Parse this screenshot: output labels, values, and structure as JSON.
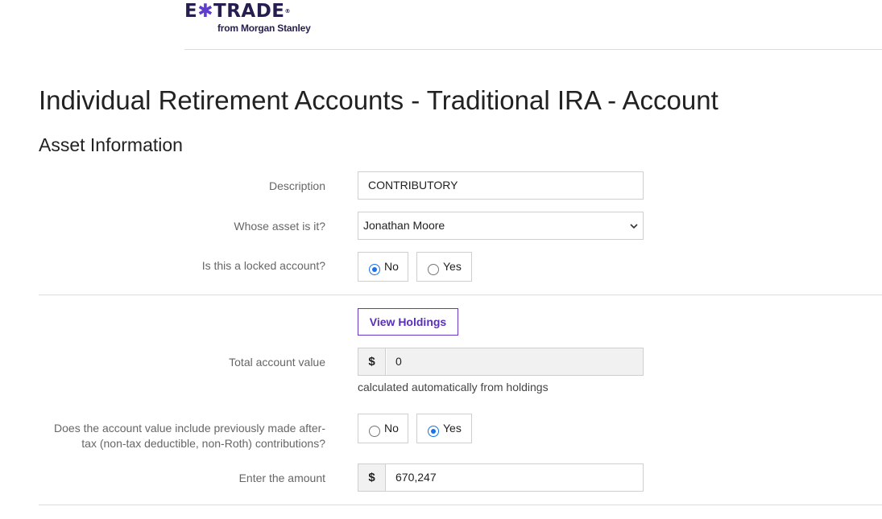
{
  "brand": {
    "logo_parts": [
      "E",
      "✱",
      "TRADE"
    ],
    "registered": "®",
    "sub": "from Morgan Stanley",
    "colors": {
      "navy": "#241f4f",
      "purple": "#5f3bd1"
    }
  },
  "page": {
    "title": "Individual Retirement Accounts - Traditional IRA - Account",
    "section": "Asset Information"
  },
  "form": {
    "description": {
      "label": "Description",
      "value": "CONTRIBUTORY"
    },
    "owner": {
      "label": "Whose asset is it?",
      "value": "Jonathan Moore",
      "icon": "chevron-down-icon"
    },
    "locked": {
      "label": "Is this a locked account?",
      "options": [
        "No",
        "Yes"
      ],
      "selected": "No"
    },
    "view_holdings": "View Holdings",
    "total": {
      "label": "Total account value",
      "currency": "$",
      "value": "0",
      "helper": "calculated automatically from holdings"
    },
    "after_tax": {
      "label_line1": "Does the account value include previously made after-",
      "label_line2": "tax (non-tax deductible, non-Roth) contributions?",
      "options": [
        "No",
        "Yes"
      ],
      "selected": "Yes"
    },
    "amount": {
      "label": "Enter the amount",
      "currency": "$",
      "value": "670,247"
    }
  },
  "colors": {
    "accent": "#1a73e8",
    "button": "#5a2fb8",
    "border": "#cfcfcf"
  }
}
